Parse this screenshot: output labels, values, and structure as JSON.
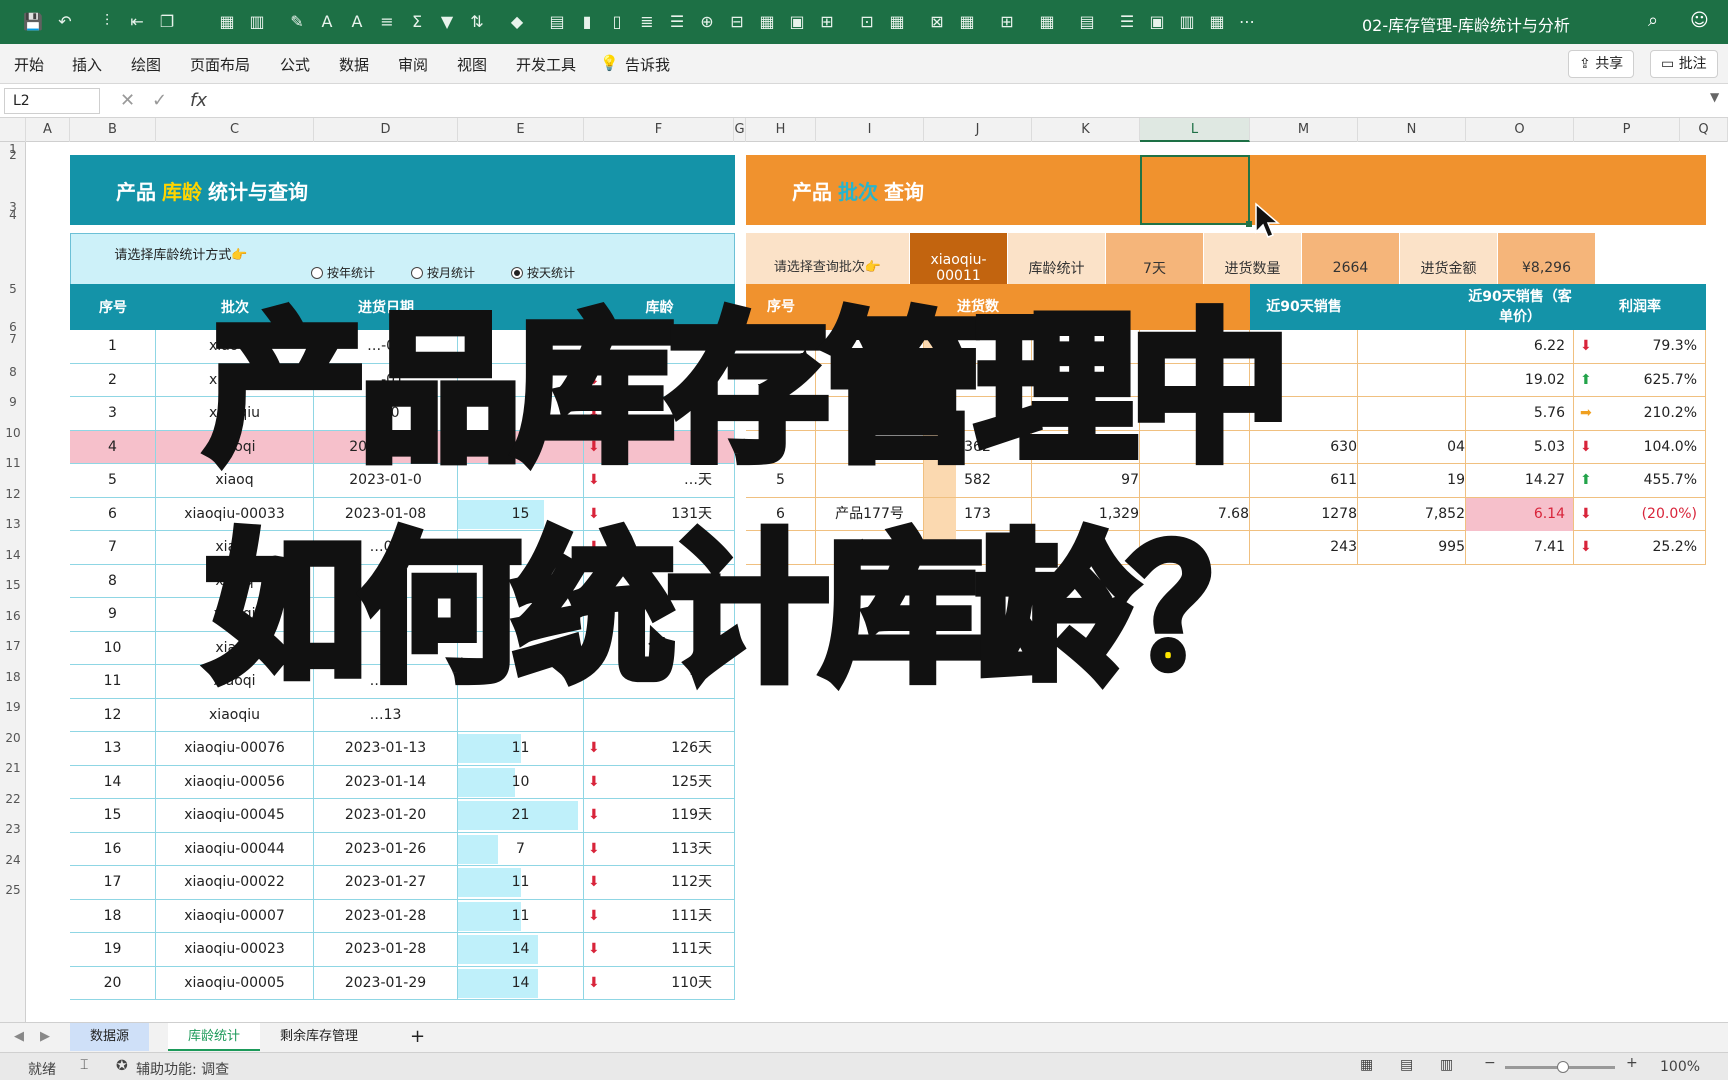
{
  "window": {
    "title": "02-库存管理-库龄统计与分析"
  },
  "menu": [
    "开始",
    "插入",
    "绘图",
    "页面布局",
    "公式",
    "数据",
    "审阅",
    "视图",
    "开发工具",
    "告诉我"
  ],
  "ribbon": {
    "share": "共享",
    "comment": "批注"
  },
  "formula": {
    "cell_ref": "L2",
    "value": ""
  },
  "columns": [
    "A",
    "B",
    "C",
    "D",
    "E",
    "F",
    "G",
    "H",
    "I",
    "J",
    "K",
    "L",
    "M",
    "N",
    "O",
    "P",
    "Q"
  ],
  "rows": [
    "1",
    "2",
    "3",
    "4",
    "5",
    "6",
    "7",
    "8",
    "9",
    "10",
    "11",
    "12",
    "13",
    "14",
    "15",
    "16",
    "17",
    "18",
    "19",
    "20",
    "21",
    "22",
    "23",
    "24",
    "25"
  ],
  "left_panel": {
    "title_a": "产品",
    "title_hl": "库龄",
    "title_b": "统计与查询",
    "select_label": "请选择库龄统计方式👉",
    "options": [
      "按年统计",
      "按月统计",
      "按天统计"
    ],
    "selected": "按天统计",
    "headers": [
      "序号",
      "批次",
      "进货日期",
      "",
      "库龄"
    ]
  },
  "left_rows": [
    {
      "no": "1",
      "batch": "xiaoqiu",
      "date": "…-01",
      "qty": "",
      "age": "",
      "arrow": "down"
    },
    {
      "no": "2",
      "batch": "xiaoqiu",
      "date": "…-01",
      "qty": "",
      "age": "",
      "arrow": "down"
    },
    {
      "no": "3",
      "batch": "xiaoqiu",
      "date": "…-0",
      "qty": "",
      "age": "",
      "arrow": "down"
    },
    {
      "no": "4",
      "batch": "xiaoqi",
      "date": "2023-01-0",
      "qty": "",
      "age": "",
      "arrow": "down",
      "hi": true
    },
    {
      "no": "5",
      "batch": "xiaoq",
      "date": "2023-01-0",
      "qty": "",
      "age": "…天",
      "arrow": "down"
    },
    {
      "no": "6",
      "batch": "xiaoqiu-00033",
      "date": "2023-01-08",
      "qty": "15",
      "age": "131天",
      "arrow": "down"
    },
    {
      "no": "7",
      "batch": "xiaoq",
      "date": "…08",
      "qty": "",
      "age": "",
      "arrow": "down"
    },
    {
      "no": "8",
      "batch": "xiaoq",
      "date": "",
      "qty": "",
      "age": "",
      "arrow": ""
    },
    {
      "no": "9",
      "batch": "xiaoqi",
      "date": "",
      "qty": "",
      "age": "",
      "arrow": ""
    },
    {
      "no": "10",
      "batch": "xiaoq",
      "date": "",
      "qty": "",
      "age": "",
      "arrow": ""
    },
    {
      "no": "11",
      "batch": "xiaoqi",
      "date": "…12",
      "qty": "",
      "age": "",
      "arrow": ""
    },
    {
      "no": "12",
      "batch": "xiaoqiu",
      "date": "…13",
      "qty": "",
      "age": "",
      "arrow": ""
    },
    {
      "no": "13",
      "batch": "xiaoqiu-00076",
      "date": "2023-01-13",
      "qty": "11",
      "age": "126天",
      "arrow": "down"
    },
    {
      "no": "14",
      "batch": "xiaoqiu-00056",
      "date": "2023-01-14",
      "qty": "10",
      "age": "125天",
      "arrow": "down"
    },
    {
      "no": "15",
      "batch": "xiaoqiu-00045",
      "date": "2023-01-20",
      "qty": "21",
      "age": "119天",
      "arrow": "down"
    },
    {
      "no": "16",
      "batch": "xiaoqiu-00044",
      "date": "2023-01-26",
      "qty": "7",
      "age": "113天",
      "arrow": "down"
    },
    {
      "no": "17",
      "batch": "xiaoqiu-00022",
      "date": "2023-01-27",
      "qty": "11",
      "age": "112天",
      "arrow": "down"
    },
    {
      "no": "18",
      "batch": "xiaoqiu-00007",
      "date": "2023-01-28",
      "qty": "11",
      "age": "111天",
      "arrow": "down"
    },
    {
      "no": "19",
      "batch": "xiaoqiu-00023",
      "date": "2023-01-28",
      "qty": "14",
      "age": "111天",
      "arrow": "down"
    },
    {
      "no": "20",
      "batch": "xiaoqiu-00005",
      "date": "2023-01-29",
      "qty": "14",
      "age": "110天",
      "arrow": "down"
    }
  ],
  "right_panel": {
    "title_a": "产品",
    "title_hl": "批次",
    "title_b": "查询",
    "q_label": "请选择查询批次👉",
    "q_batch": "xiaoqiu-00011",
    "q_age_label": "库龄统计",
    "q_age": "7天",
    "q_qty_label": "进货数量",
    "q_qty": "2664",
    "q_amt_label": "进货金额",
    "q_amt": "¥8,296",
    "headers": [
      "序号",
      "",
      "进货数",
      "",
      "",
      "",
      "近90天销售",
      "",
      "近90天销售（客单价）",
      "利润率"
    ]
  },
  "right_rows": [
    {
      "c1": "",
      "c2": "",
      "c3": "",
      "c4": "",
      "price": "6.22",
      "profit": "79.3%",
      "arrow": "down"
    },
    {
      "c1": "2",
      "c2": "",
      "c3": "",
      "c4": "",
      "price": "19.02",
      "profit": "625.7%",
      "arrow": "up"
    },
    {
      "c1": "",
      "c2": "",
      "c3": "",
      "c4": "",
      "price": "5.76",
      "profit": "210.2%",
      "arrow": "right"
    },
    {
      "c1": "",
      "c2": "",
      "c3": "362",
      "c4": "93",
      "m": "630",
      "n": "04",
      "price": "5.03",
      "profit": "104.0%",
      "arrow": "down"
    },
    {
      "c1": "5",
      "c2": "",
      "c3": "582",
      "c4": "97",
      "m": "611",
      "n": "19",
      "price": "14.27",
      "profit": "455.7%",
      "arrow": "up"
    },
    {
      "c1": "6",
      "c2": "产品177号",
      "c3": "173",
      "c4": "1,329",
      "j": "7.68",
      "m": "1278",
      "n": "7,852",
      "price": "6.14",
      "profit": "(20.0%)",
      "arrow": "down",
      "neg": true
    },
    {
      "c1": "7",
      "c2": "产品",
      "c3": "",
      "c4": "",
      "m": "243",
      "n": "995",
      "price": "7.41",
      "profit": "25.2%",
      "arrow": "down"
    }
  ],
  "overlay": {
    "line1": "产品库存管理中",
    "line2a": "如何",
    "line2b": "统计库龄",
    "line2c": "？"
  },
  "sheets": [
    "数据源",
    "库龄统计",
    "剩余库存管理",
    "+"
  ],
  "status": {
    "ready": "就绪",
    "accessibility": "辅助功能: 调查",
    "zoom": "100%"
  }
}
